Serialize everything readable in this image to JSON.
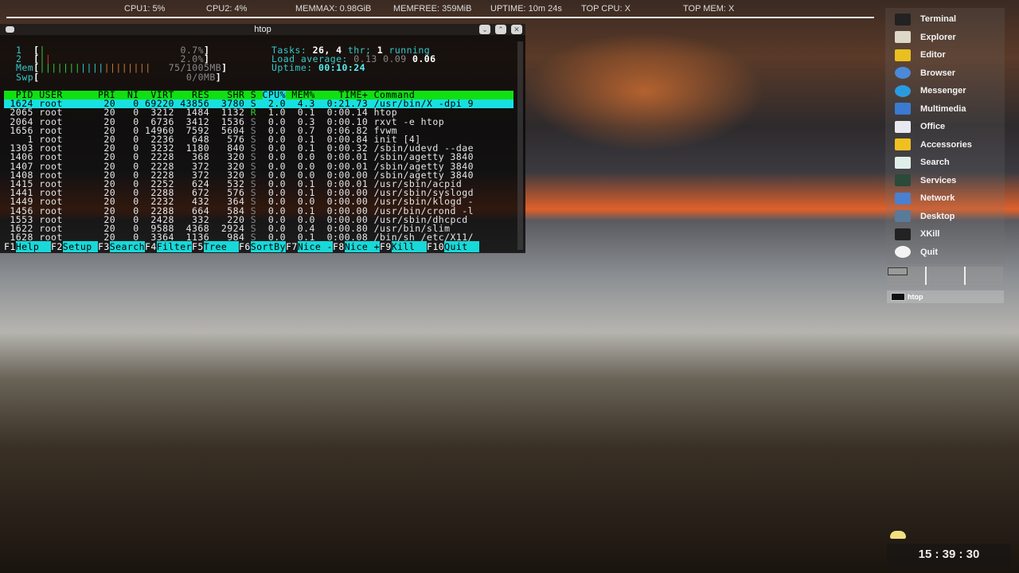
{
  "topbar": {
    "cpu1": "CPU1: 5%",
    "cpu2": "CPU2: 4%",
    "memmax": "MEMMAX: 0.98GiB",
    "memfree": "MEMFREE: 359MiB",
    "uptime": "UPTIME: 10m 24s",
    "topcpu": "TOP CPU: X",
    "topmem": "TOP MEM: X"
  },
  "window": {
    "title": "htop"
  },
  "htop": {
    "cpu1": {
      "label": "1",
      "value": "0.7%"
    },
    "cpu2": {
      "label": "2",
      "value": "2.0%"
    },
    "mem": {
      "label": "Mem",
      "value": "75/1005MB"
    },
    "swp": {
      "label": "Swp",
      "value": "0/0MB"
    },
    "tasks_label": "Tasks:",
    "tasks": "26,",
    "thr": "4",
    "thr_label": "thr;",
    "running": "1",
    "running_label": "running",
    "load_label": "Load average:",
    "load1": "0.13",
    "load5": "0.09",
    "load15": "0.06",
    "uptime_label": "Uptime:",
    "uptime": "00:10:24",
    "columns": [
      "PID",
      "USER",
      "PRI",
      "NI",
      "VIRT",
      "RES",
      "SHR",
      "S",
      "CPU%",
      "MEM%",
      "TIME+",
      "Command"
    ],
    "processes": [
      [
        "1624",
        "root",
        "20",
        "0",
        "69220",
        "43856",
        "3780",
        "S",
        "2.0",
        "4.3",
        "0:21.73",
        "/usr/bin/X -dpi 9"
      ],
      [
        "2065",
        "root",
        "20",
        "0",
        "3212",
        "1484",
        "1132",
        "R",
        "1.0",
        "0.1",
        "0:00.14",
        "htop"
      ],
      [
        "2064",
        "root",
        "20",
        "0",
        "6736",
        "3412",
        "1536",
        "S",
        "0.0",
        "0.3",
        "0:00.10",
        "rxvt -e htop"
      ],
      [
        "1656",
        "root",
        "20",
        "0",
        "14960",
        "7592",
        "5604",
        "S",
        "0.0",
        "0.7",
        "0:06.82",
        "fvwm"
      ],
      [
        "1",
        "root",
        "20",
        "0",
        "2236",
        "648",
        "576",
        "S",
        "0.0",
        "0.1",
        "0:00.84",
        "init [4]"
      ],
      [
        "1303",
        "root",
        "20",
        "0",
        "3232",
        "1180",
        "840",
        "S",
        "0.0",
        "0.1",
        "0:00.32",
        "/sbin/udevd --dae"
      ],
      [
        "1406",
        "root",
        "20",
        "0",
        "2228",
        "368",
        "320",
        "S",
        "0.0",
        "0.0",
        "0:00.01",
        "/sbin/agetty 3840"
      ],
      [
        "1407",
        "root",
        "20",
        "0",
        "2228",
        "372",
        "320",
        "S",
        "0.0",
        "0.0",
        "0:00.01",
        "/sbin/agetty 3840"
      ],
      [
        "1408",
        "root",
        "20",
        "0",
        "2228",
        "372",
        "320",
        "S",
        "0.0",
        "0.0",
        "0:00.00",
        "/sbin/agetty 3840"
      ],
      [
        "1415",
        "root",
        "20",
        "0",
        "2252",
        "624",
        "532",
        "S",
        "0.0",
        "0.1",
        "0:00.01",
        "/usr/sbin/acpid"
      ],
      [
        "1441",
        "root",
        "20",
        "0",
        "2288",
        "672",
        "576",
        "S",
        "0.0",
        "0.1",
        "0:00.00",
        "/usr/sbin/syslogd"
      ],
      [
        "1449",
        "root",
        "20",
        "0",
        "2232",
        "432",
        "364",
        "S",
        "0.0",
        "0.0",
        "0:00.00",
        "/usr/sbin/klogd -"
      ],
      [
        "1456",
        "root",
        "20",
        "0",
        "2288",
        "664",
        "584",
        "S",
        "0.0",
        "0.1",
        "0:00.00",
        "/usr/bin/crond -l"
      ],
      [
        "1553",
        "root",
        "20",
        "0",
        "2428",
        "332",
        "220",
        "S",
        "0.0",
        "0.0",
        "0:00.00",
        "/usr/sbin/dhcpcd"
      ],
      [
        "1622",
        "root",
        "20",
        "0",
        "9588",
        "4368",
        "2924",
        "S",
        "0.0",
        "0.4",
        "0:00.80",
        "/usr/bin/slim"
      ],
      [
        "1628",
        "root",
        "20",
        "0",
        "3364",
        "1136",
        "984",
        "S",
        "0.0",
        "0.1",
        "0:00.08",
        "/bin/sh /etc/X11/"
      ]
    ],
    "fkeys": [
      [
        "F1",
        "Help  "
      ],
      [
        "F2",
        "Setup "
      ],
      [
        "F3",
        "Search"
      ],
      [
        "F4",
        "Filter"
      ],
      [
        "F5",
        "Tree  "
      ],
      [
        "F6",
        "SortBy"
      ],
      [
        "F7",
        "Nice -"
      ],
      [
        "F8",
        "Nice +"
      ],
      [
        "F9",
        "Kill  "
      ],
      [
        "F10",
        "Quit  "
      ]
    ]
  },
  "menu": [
    {
      "label": "Terminal",
      "icon": "terminal-icon",
      "color": "#222"
    },
    {
      "label": "Explorer",
      "icon": "file-manager-icon",
      "color": "#ddd8c8"
    },
    {
      "label": "Editor",
      "icon": "teapot-icon",
      "color": "#e8c020"
    },
    {
      "label": "Browser",
      "icon": "globe-icon",
      "color": "#4a8ad8"
    },
    {
      "label": "Messenger",
      "icon": "skype-icon",
      "color": "#2a9ae0"
    },
    {
      "label": "Multimedia",
      "icon": "media-player-icon",
      "color": "#3a7ad0"
    },
    {
      "label": "Office",
      "icon": "printer-icon",
      "color": "#e8e8f0"
    },
    {
      "label": "Accessories",
      "icon": "folder-icon",
      "color": "#f0c020"
    },
    {
      "label": "Search",
      "icon": "search-icon",
      "color": "#e0eee8"
    },
    {
      "label": "Services",
      "icon": "monitor-icon",
      "color": "#2a4a3a"
    },
    {
      "label": "Network",
      "icon": "network-icon",
      "color": "#4a80d0"
    },
    {
      "label": "Desktop",
      "icon": "desktop-icon",
      "color": "#5a7a9a"
    },
    {
      "label": "XKill",
      "icon": "skull-icon",
      "color": "#222"
    },
    {
      "label": "Quit",
      "icon": "quit-icon",
      "color": "#f4f4f4"
    }
  ],
  "taskbar": {
    "item": "htop"
  },
  "clock": {
    "time": "15 : 39 : 30"
  }
}
